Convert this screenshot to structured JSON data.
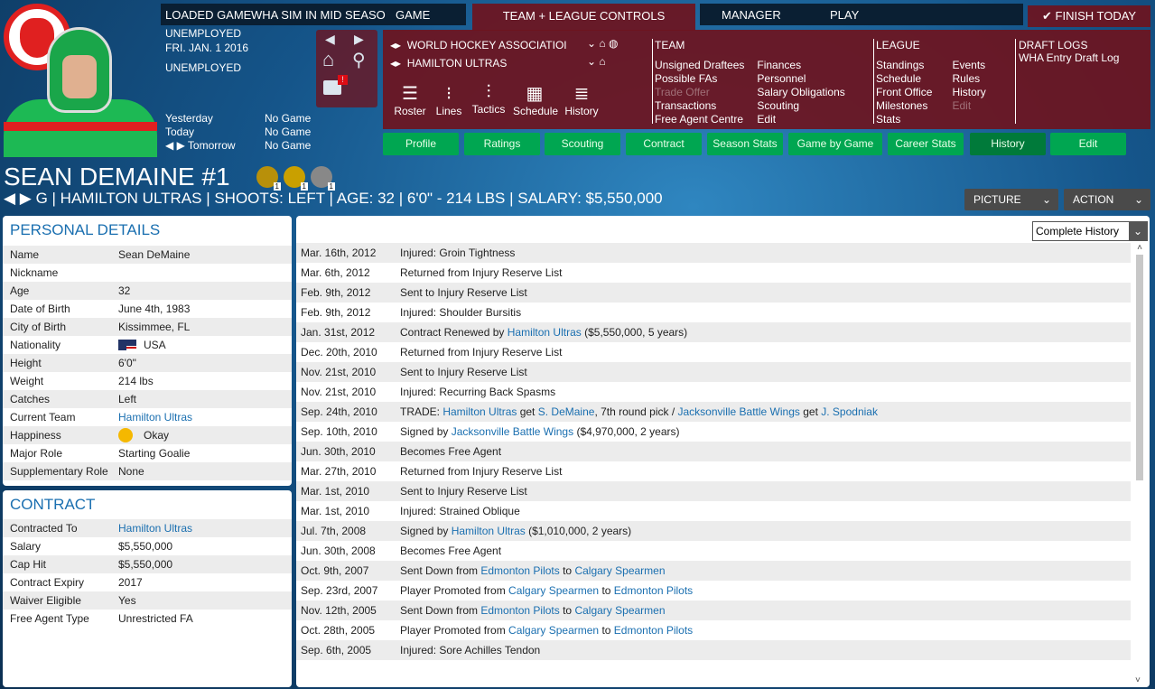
{
  "topbar": {
    "loaded_game_label": "LOADED GAME",
    "loaded_game_name": "WHA SIM IN MID SEASO",
    "game_tab": "GAME",
    "team_league_tab": "TEAM + LEAGUE CONTROLS",
    "manager_tab": "MANAGER",
    "play_tab": "PLAY",
    "finish_today": "FINISH TODAY"
  },
  "status": {
    "line1": "UNEMPLOYED",
    "date": "FRI. JAN. 1 2016",
    "line3": "UNEMPLOYED",
    "schedule": [
      {
        "label": "Yesterday",
        "value": "No Game"
      },
      {
        "label": "Today",
        "value": "No Game"
      },
      {
        "label": "Tomorrow",
        "value": "No Game"
      }
    ]
  },
  "controls": {
    "league": "WORLD HOCKEY ASSOCIATIOI",
    "team": "HAMILTON ULTRAS",
    "icons": [
      "Roster",
      "Lines",
      "Tactics",
      "Schedule",
      "History"
    ],
    "team_header": "TEAM",
    "team_col1": [
      "Unsigned Draftees",
      "Possible FAs",
      "Trade Offer",
      "Transactions",
      "Free Agent Centre"
    ],
    "team_col2": [
      "Finances",
      "Personnel",
      "Salary Obligations",
      "Scouting",
      "Edit"
    ],
    "league_header": "LEAGUE",
    "league_col1": [
      "Standings",
      "Schedule",
      "Front Office",
      "Milestones",
      "Stats"
    ],
    "league_col2": [
      "Events",
      "Rules",
      "History",
      "Edit"
    ],
    "draft_header": "DRAFT LOGS",
    "draft_items": [
      "WHA Entry Draft Log"
    ]
  },
  "player_tabs": [
    "Profile",
    "Ratings",
    "Scouting",
    "Contract",
    "Season Stats",
    "Game by Game",
    "Career Stats",
    "History",
    "Edit"
  ],
  "player": {
    "name": "SEAN DEMAINE #1",
    "subtitle": "G | HAMILTON ULTRAS | SHOOTS: LEFT | AGE: 32 | 6'0\" - 214 LBS | SALARY: $5,550,000",
    "badges": [
      "1",
      "1",
      "1"
    ]
  },
  "buttons": {
    "picture": "PICTURE",
    "action": "ACTION"
  },
  "personal": {
    "title": "PERSONAL DETAILS",
    "rows": [
      [
        "Name",
        "Sean DeMaine"
      ],
      [
        "Nickname",
        ""
      ],
      [
        "Age",
        "32"
      ],
      [
        "Date of Birth",
        "June 4th, 1983"
      ],
      [
        "City of Birth",
        "Kissimmee, FL"
      ],
      [
        "Nationality",
        "USA"
      ],
      [
        "Height",
        "6'0\""
      ],
      [
        "Weight",
        "214 lbs"
      ],
      [
        "Catches",
        "Left"
      ],
      [
        "Current Team",
        "Hamilton Ultras"
      ],
      [
        "Happiness",
        "Okay"
      ],
      [
        "Major Role",
        "Starting Goalie"
      ],
      [
        "Supplementary Role",
        "None"
      ]
    ]
  },
  "contract": {
    "title": "CONTRACT",
    "rows": [
      [
        "Contracted To",
        "Hamilton Ultras"
      ],
      [
        "Salary",
        "$5,550,000"
      ],
      [
        "Cap Hit",
        "$5,550,000"
      ],
      [
        "Contract Expiry",
        "2017"
      ],
      [
        "Waiver Eligible",
        "Yes"
      ],
      [
        "Free Agent Type",
        "Unrestricted FA"
      ]
    ]
  },
  "history": {
    "filter": "Complete History",
    "rows": [
      [
        "Mar. 16th, 2012",
        "Injured: Groin Tightness"
      ],
      [
        "Mar. 6th, 2012",
        "Returned from Injury Reserve List"
      ],
      [
        "Feb. 9th, 2012",
        "Sent to Injury Reserve List"
      ],
      [
        "Feb. 9th, 2012",
        "Injured: Shoulder Bursitis"
      ],
      [
        "Jan. 31st, 2012",
        "Contract Renewed by |Hamilton Ultras| ($5,550,000, 5 years)"
      ],
      [
        "Dec. 20th, 2010",
        "Returned from Injury Reserve List"
      ],
      [
        "Nov. 21st, 2010",
        "Sent to Injury Reserve List"
      ],
      [
        "Nov. 21st, 2010",
        "Injured: Recurring Back Spasms"
      ],
      [
        "Sep. 24th, 2010",
        "TRADE: |Hamilton Ultras| get |S. DeMaine|, 7th round pick / |Jacksonville Battle Wings| get |J. Spodniak"
      ],
      [
        "Sep. 10th, 2010",
        "Signed by |Jacksonville Battle Wings| ($4,970,000, 2 years)"
      ],
      [
        "Jun. 30th, 2010",
        "Becomes Free Agent"
      ],
      [
        "Mar. 27th, 2010",
        "Returned from Injury Reserve List"
      ],
      [
        "Mar. 1st, 2010",
        "Sent to Injury Reserve List"
      ],
      [
        "Mar. 1st, 2010",
        "Injured: Strained Oblique"
      ],
      [
        "Jul. 7th, 2008",
        "Signed by |Hamilton Ultras| ($1,010,000, 2 years)"
      ],
      [
        "Jun. 30th, 2008",
        "Becomes Free Agent"
      ],
      [
        "Oct. 9th, 2007",
        "Sent Down from |Edmonton Pilots| to |Calgary Spearmen"
      ],
      [
        "Sep. 23rd, 2007",
        "Player Promoted from |Calgary Spearmen| to |Edmonton Pilots"
      ],
      [
        "Nov. 12th, 2005",
        "Sent Down from |Edmonton Pilots| to |Calgary Spearmen"
      ],
      [
        "Oct. 28th, 2005",
        "Player Promoted from |Calgary Spearmen| to |Edmonton Pilots"
      ],
      [
        "Sep. 6th, 2005",
        "Injured: Sore Achilles Tendon"
      ]
    ]
  },
  "colors": {
    "accent": "#00a651",
    "maroon": "#6e141e",
    "link": "#1a6fb0"
  }
}
